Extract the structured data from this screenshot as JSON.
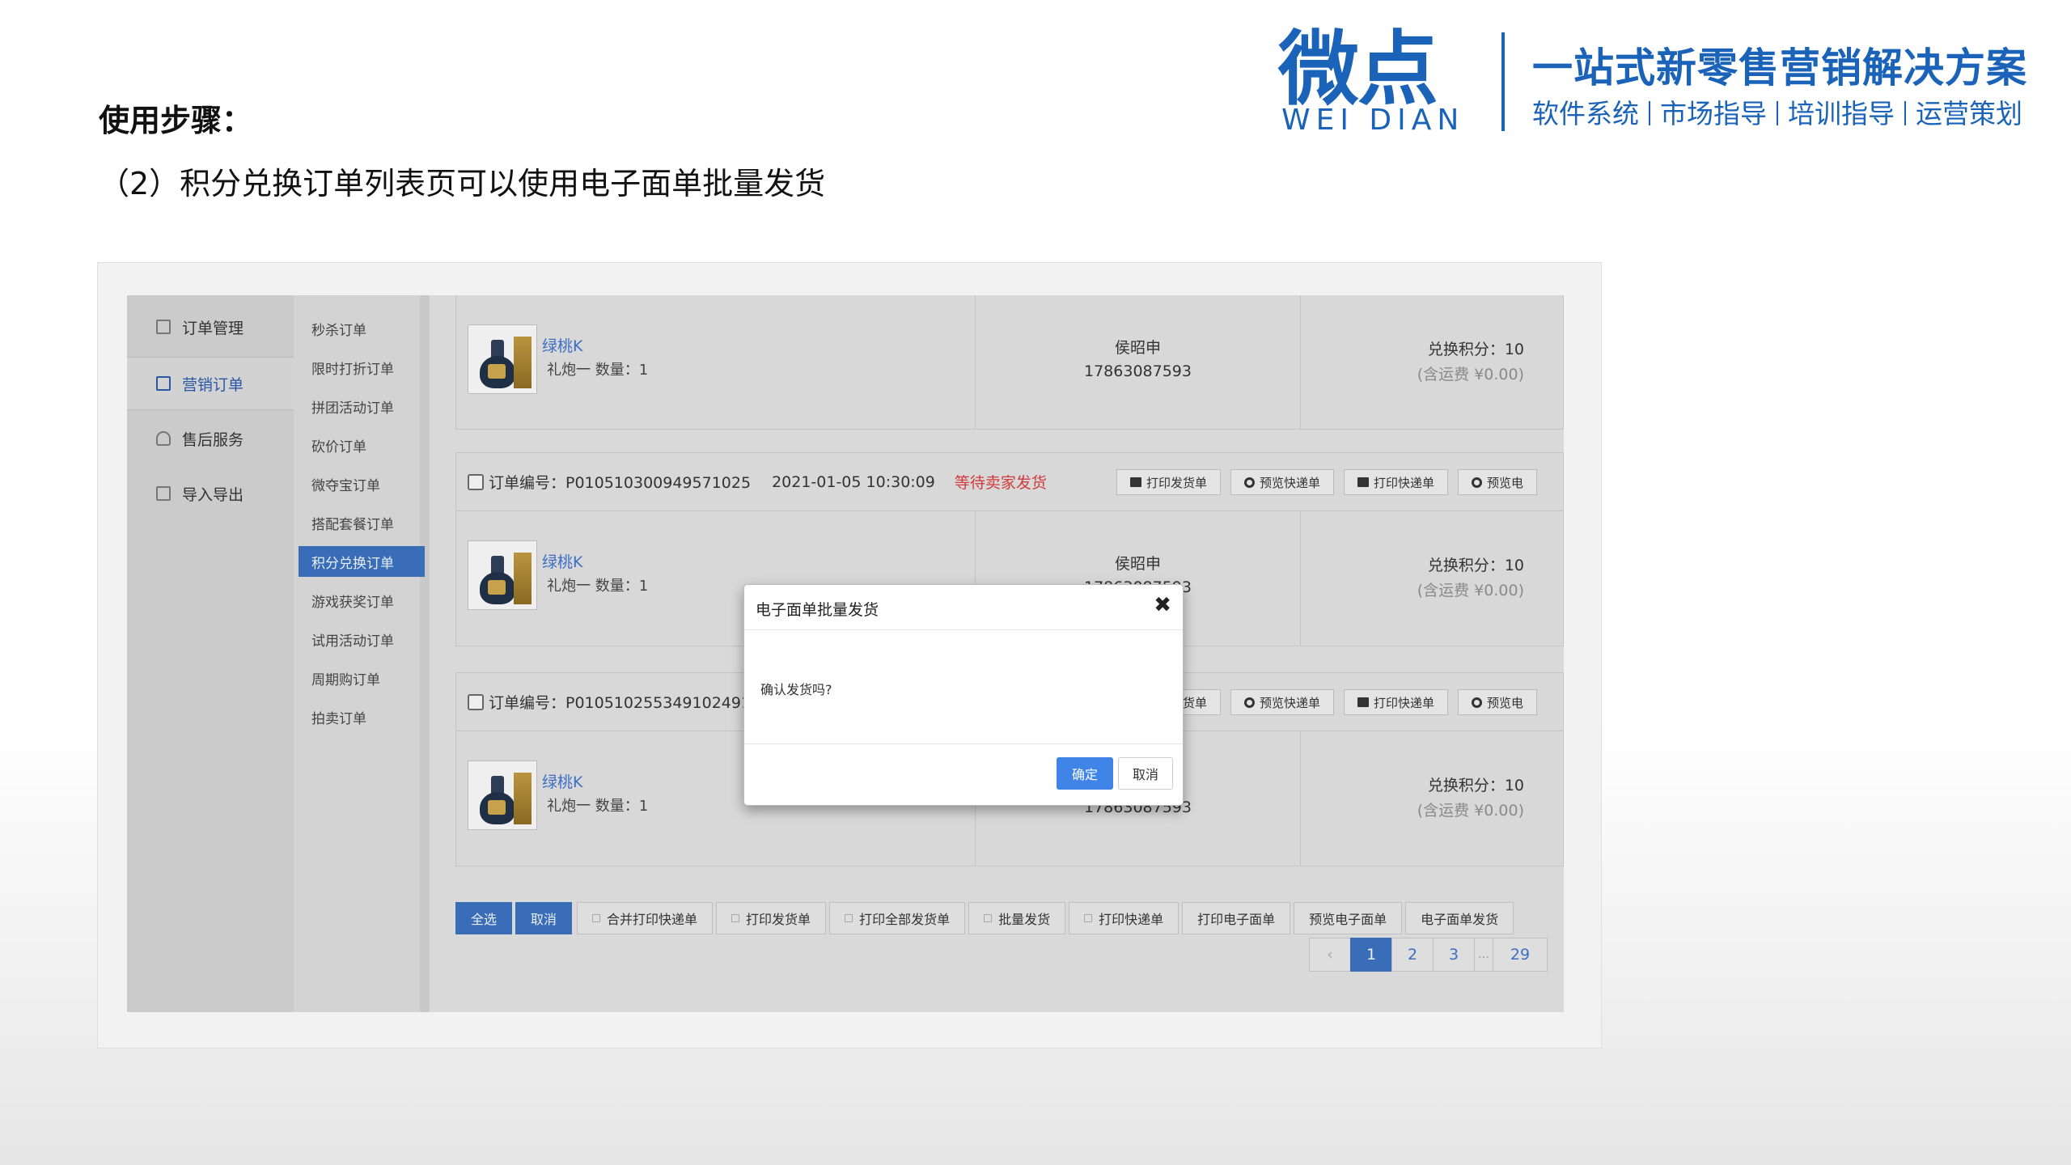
{
  "slide": {
    "heading": "使用步骤：",
    "subheading": "（2）积分兑换订单列表页可以使用电子面单批量发货"
  },
  "logo": {
    "main": "微点",
    "english": "WEI DIAN",
    "slogan": "一站式新零售营销解决方案",
    "services": [
      "软件系统",
      "市场指导",
      "培训指导",
      "运营策划"
    ]
  },
  "nav_primary": [
    {
      "label": "订单管理",
      "icon": "document-icon",
      "active": false
    },
    {
      "label": "营销订单",
      "icon": "list-icon",
      "active": true
    },
    {
      "label": "售后服务",
      "icon": "headset-icon",
      "active": false
    },
    {
      "label": "导入导出",
      "icon": "import-icon",
      "active": false
    }
  ],
  "nav_secondary": [
    {
      "label": "秒杀订单",
      "active": false
    },
    {
      "label": "限时打折订单",
      "active": false
    },
    {
      "label": "拼团活动订单",
      "active": false
    },
    {
      "label": "砍价订单",
      "active": false
    },
    {
      "label": "微夺宝订单",
      "active": false
    },
    {
      "label": "搭配套餐订单",
      "active": false
    },
    {
      "label": "积分兑换订单",
      "active": true
    },
    {
      "label": "游戏获奖订单",
      "active": false
    },
    {
      "label": "试用活动订单",
      "active": false
    },
    {
      "label": "周期购订单",
      "active": false
    },
    {
      "label": "拍卖订单",
      "active": false
    }
  ],
  "order_actions": [
    "打印发货单",
    "预览快递单",
    "打印快递单",
    "预览电"
  ],
  "orders": [
    {
      "order_no": "",
      "time": "",
      "status": "",
      "goods_name": "绿桃K",
      "goods_spec": "礼炮一   数量：1",
      "buyer_name": "侯昭申",
      "buyer_phone": "17863087593",
      "points": "兑换积分：10",
      "freight": "(含运费 ¥0.00)"
    },
    {
      "order_no": "订单编号：P010510300949571025",
      "time": "2021-01-05 10:30:09",
      "status": "等待卖家发货",
      "goods_name": "绿桃K",
      "goods_spec": "礼炮一   数量：1",
      "buyer_name": "侯昭申",
      "buyer_phone": "17863087593",
      "points": "兑换积分：10",
      "freight": "(含运费 ¥0.00)"
    },
    {
      "order_no": "订单编号：P0105102553491024918",
      "time": "",
      "status": "",
      "goods_name": "绿桃K",
      "goods_spec": "礼炮一   数量：1",
      "buyer_name": "侯昭申",
      "buyer_phone": "17863087593",
      "points": "兑换积分：10",
      "freight": "(含运费 ¥0.00)"
    }
  ],
  "bottom_buttons": {
    "select_all": "全选",
    "cancel": "取消",
    "actions": [
      "合并打印快递单",
      "打印发货单",
      "打印全部发货单",
      "批量发货",
      "打印快递单",
      "打印电子面单",
      "预览电子面单",
      "电子面单发货"
    ]
  },
  "pagination": {
    "prev": "‹",
    "pages": [
      "1",
      "2",
      "3"
    ],
    "ellipsis": "…",
    "last": "29",
    "current": "1"
  },
  "modal": {
    "title": "电子面单批量发货",
    "close": "✖",
    "message": "确认发货吗?",
    "ok": "确定",
    "cancel": "取消"
  },
  "colors": {
    "brand": "#1a63b8",
    "accent": "#3a6db8",
    "status_red": "#d23b3b",
    "modal_ok": "#3f84e6"
  }
}
